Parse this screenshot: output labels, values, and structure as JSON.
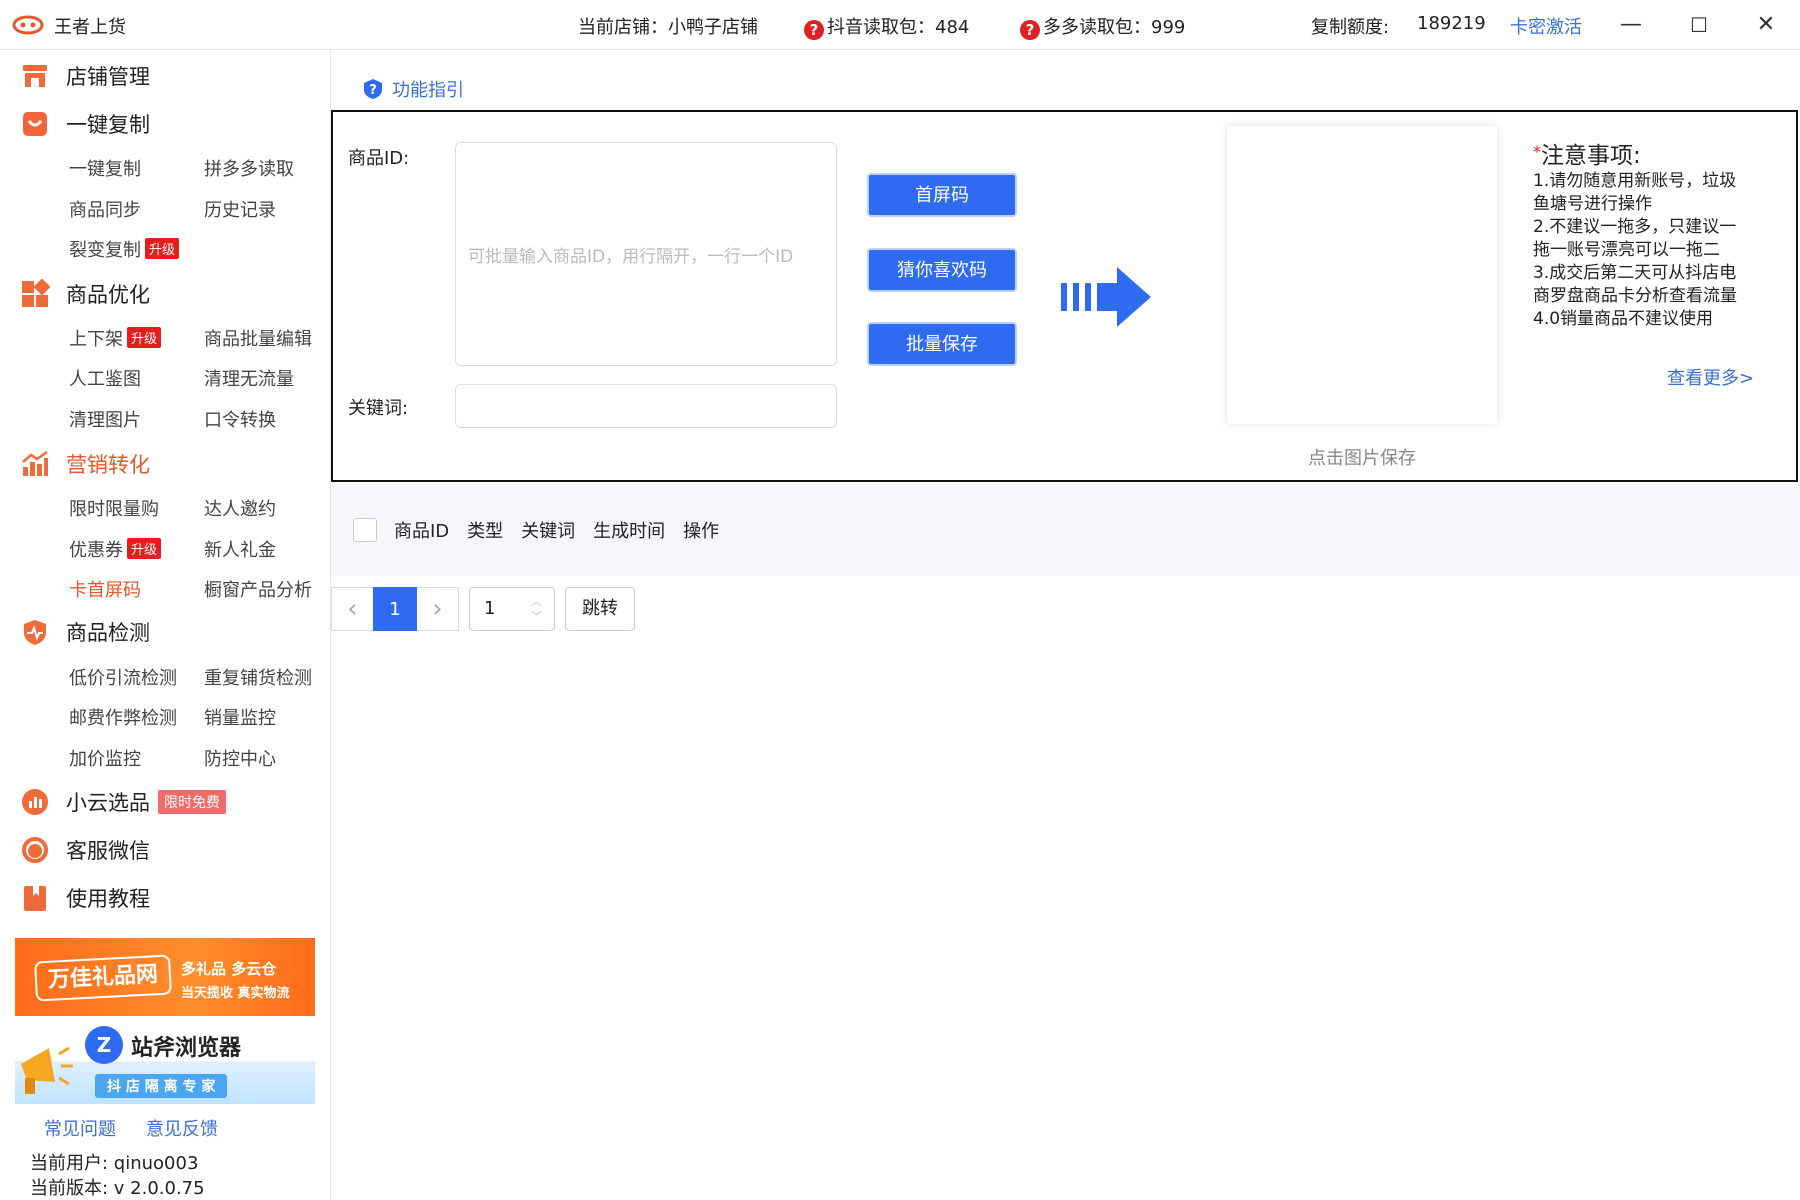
{
  "titlebar": {
    "app_title": "王者上货",
    "store_label": "当前店铺：小鸭子店铺",
    "douyin_label": "抖音读取包：484",
    "duoduo_label": "多多读取包：999",
    "quota_label": "复制额度:",
    "quota_value": "189219",
    "activate_link": "卡密激活",
    "minimize": "—",
    "maximize": "☐",
    "close": "✕"
  },
  "sidebar": {
    "sections": {
      "store": "店铺管理",
      "copy": "一键复制",
      "optimize": "商品优化",
      "marketing": "营销转化",
      "detect": "商品检测",
      "xiaoyun": "小云选品",
      "service": "客服微信",
      "tutorial": "使用教程"
    },
    "copy_items": [
      "一键复制",
      "拼多多读取",
      "商品同步",
      "历史记录",
      "裂变复制"
    ],
    "optimize_items": [
      "上下架",
      "商品批量编辑",
      "人工鉴图",
      "清理无流量",
      "清理图片",
      "口令转换"
    ],
    "marketing_items": [
      "限时限量购",
      "达人邀约",
      "优惠券",
      "新人礼金",
      "卡首屏码",
      "橱窗产品分析"
    ],
    "detect_items": [
      "低价引流检测",
      "重复铺货检测",
      "邮费作弊检测",
      "销量监控",
      "加价监控",
      "防控中心"
    ],
    "badge_upgrade": "升级",
    "badge_free": "限时免费",
    "banner1": {
      "brand": "万佳礼品网",
      "line1": "多礼品 多云仓",
      "line2": "当天揽收 真实物流"
    },
    "banner2": {
      "brand": "站斧浏览器",
      "line1": "抖 店 隔 离 专 家"
    },
    "faq_link": "常见问题",
    "feedback_link": "意见反馈",
    "user_info": "当前用户: qinuo003",
    "version_info": "当前版本: v 2.0.0.75"
  },
  "main": {
    "guide": "功能指引",
    "product_id_label": "商品ID:",
    "id_placeholder": "可批量输入商品ID，用行隔开，一行一个ID",
    "keyword_label": "关键词:",
    "btn_first_screen": "首屏码",
    "btn_guess": "猜你喜欢码",
    "btn_batch_save": "批量保存",
    "qr_caption": "点击图片保存",
    "notes_title": "注意事项:",
    "notes_star": "*",
    "notes_lines": [
      "1.请勿随意用新账号，垃圾",
      "鱼塘号进行操作",
      "2.不建议一拖多，只建议一",
      "拖一账号漂亮可以一拖二",
      "3.成交后第二天可从抖店电",
      "商罗盘商品卡分析查看流量",
      "4.0销量商品不建议使用"
    ],
    "more_link": "查看更多>"
  },
  "table": {
    "headers": [
      "商品ID",
      "类型",
      "关键词",
      "生成时间",
      "操作"
    ]
  },
  "pager": {
    "prev": "‹",
    "current": "1",
    "next": "›",
    "jump_value": "1",
    "jump_button": "跳转"
  },
  "colors": {
    "accent_blue": "#2f6bf0",
    "link_blue": "#3b6fd8",
    "active_orange": "#e8562a",
    "badge_red": "#e81c1c"
  }
}
